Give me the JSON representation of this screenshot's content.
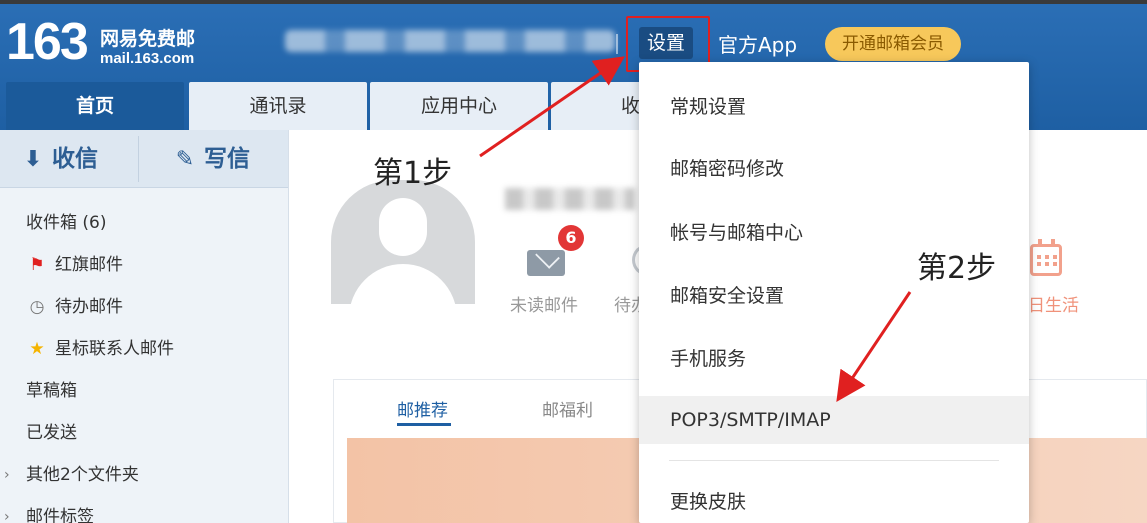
{
  "header": {
    "logo_number": "163",
    "logo_name": "网易免费邮",
    "logo_domain": "mail.163.com",
    "settings_label": "设置",
    "app_label": "官方App",
    "vip_label": "开通邮箱会员"
  },
  "tabs": [
    {
      "label": "首页"
    },
    {
      "label": "通讯录"
    },
    {
      "label": "应用中心"
    },
    {
      "label": "收件"
    }
  ],
  "sidebar": {
    "receive_label": "收信",
    "compose_label": "写信",
    "items": [
      {
        "label": "收件箱 (6)"
      },
      {
        "label": "红旗邮件"
      },
      {
        "label": "待办邮件"
      },
      {
        "label": "星标联系人邮件"
      },
      {
        "label": "草稿箱"
      },
      {
        "label": "已发送"
      },
      {
        "label": "其他2个文件夹"
      },
      {
        "label": "邮件标签"
      }
    ]
  },
  "main": {
    "unread_count": "6",
    "unread_label": "未读邮件",
    "todo_label_partial": "待办",
    "life_label": "日生活",
    "card_tabs": [
      {
        "label": "邮推荐"
      },
      {
        "label": "邮福利"
      }
    ]
  },
  "settings_menu": {
    "items": [
      {
        "label": "常规设置"
      },
      {
        "label": "邮箱密码修改"
      },
      {
        "label": "帐号与邮箱中心"
      },
      {
        "label": "邮箱安全设置"
      },
      {
        "label": "手机服务"
      },
      {
        "label": "POP3/SMTP/IMAP"
      },
      {
        "label": "更换皮肤"
      }
    ]
  },
  "annotations": {
    "step1": "第1步",
    "step2": "第2步",
    "highlight_color": "#e02020"
  }
}
